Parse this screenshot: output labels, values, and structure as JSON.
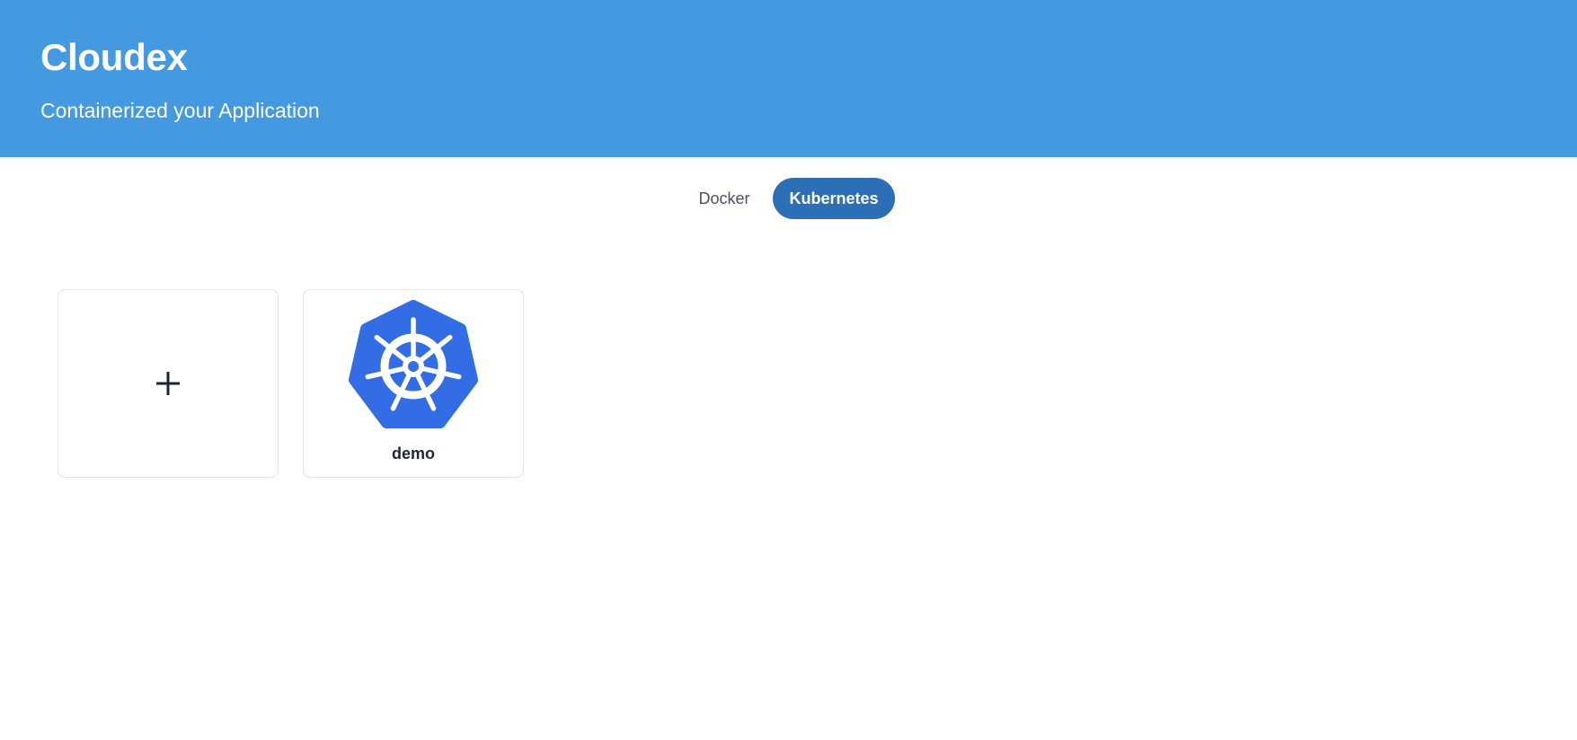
{
  "header": {
    "title": "Cloudex",
    "subtitle": "Containerized your Application"
  },
  "tabs": [
    {
      "label": "Docker",
      "active": false
    },
    {
      "label": "Kubernetes",
      "active": true
    }
  ],
  "cards": {
    "add": {
      "icon": "plus-icon"
    },
    "apps": [
      {
        "name": "demo",
        "icon": "kubernetes-logo-icon"
      }
    ]
  },
  "colors": {
    "header_bg": "#4499e1",
    "active_tab_bg": "#2d6fb7",
    "kubernetes_blue": "#326de6"
  }
}
